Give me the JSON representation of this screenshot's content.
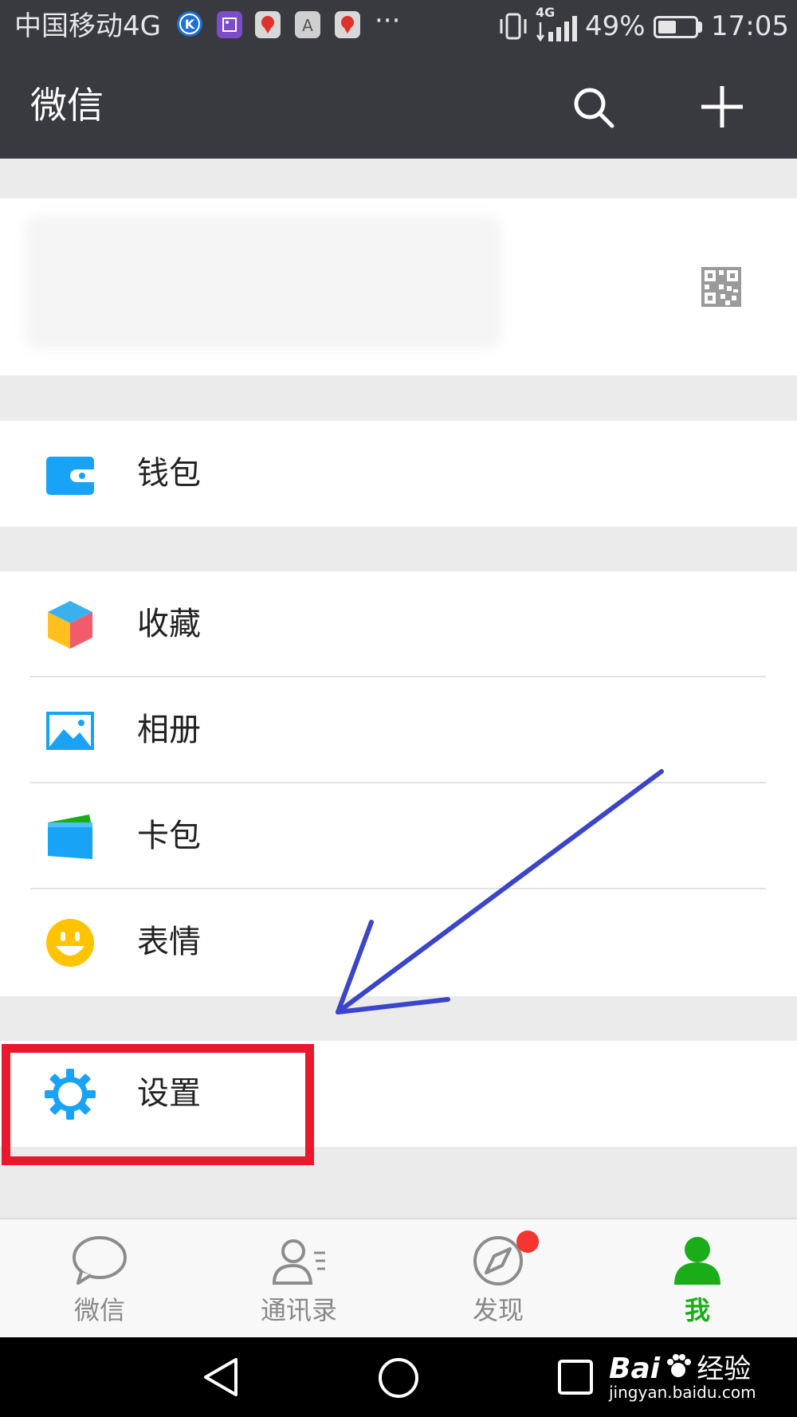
{
  "status_bar": {
    "carrier": "中国移动4G",
    "dots": "···",
    "network": "4G",
    "battery_percent": "49%",
    "battery_level": 0.49,
    "time": "17:05"
  },
  "header": {
    "title": "微信",
    "search_icon": "search-icon",
    "add_icon": "plus-icon"
  },
  "menu": {
    "wallet": "钱包",
    "favorites": "收藏",
    "album": "相册",
    "cards": "卡包",
    "stickers": "表情",
    "settings": "设置"
  },
  "tabs": [
    {
      "label": "微信",
      "icon": "chat-bubble-icon",
      "active": false
    },
    {
      "label": "通讯录",
      "icon": "contacts-icon",
      "active": false
    },
    {
      "label": "发现",
      "icon": "compass-icon",
      "active": false,
      "badge": true
    },
    {
      "label": "我",
      "icon": "person-icon",
      "active": true
    }
  ],
  "colors": {
    "header_bg": "#393a3f",
    "accent_green": "#1aad19",
    "highlight_red": "#e8192c",
    "arrow_blue": "#3b45c9",
    "icon_blue": "#19a3f7"
  },
  "watermark": {
    "brand": "Bai",
    "brand_suffix": "经验",
    "url": "jingyan.baidu.com"
  }
}
